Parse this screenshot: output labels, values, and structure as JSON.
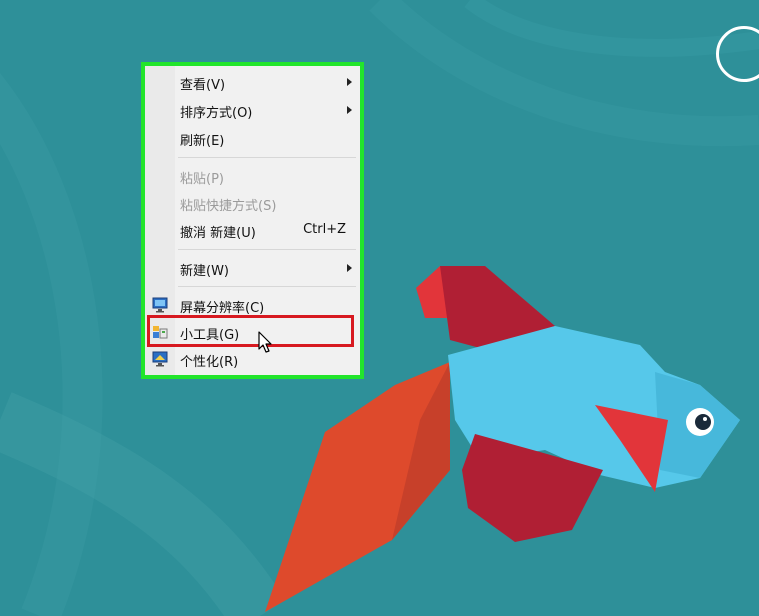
{
  "colors": {
    "desktop_bg": "#2e9099",
    "menu_frame_highlight": "#22e52b",
    "selection_highlight": "#d71920",
    "fish_body": "#56c8ea",
    "fish_red": "#b01f34",
    "fish_red_light": "#e2353a",
    "fish_tail": "#de4a2c"
  },
  "context_menu": {
    "items": [
      {
        "label": "查看(V)",
        "submenu": true
      },
      {
        "label": "排序方式(O)",
        "submenu": true
      },
      {
        "label": "刷新(E)"
      },
      {
        "label": "粘贴(P)",
        "disabled": true
      },
      {
        "label": "粘贴快捷方式(S)",
        "disabled": true
      },
      {
        "label": "撤消 新建(U)",
        "shortcut": "Ctrl+Z"
      },
      {
        "label": "新建(W)",
        "submenu": true
      },
      {
        "label": "屏幕分辨率(C)",
        "icon": "display-icon"
      },
      {
        "label": "小工具(G)",
        "icon": "gadgets-icon"
      },
      {
        "label": "个性化(R)",
        "icon": "personalize-icon"
      }
    ]
  },
  "cursor": {
    "icon": "mouse-pointer-icon"
  },
  "desktop": {
    "top_right_icon": "circle-icon",
    "wallpaper": "betta-fish"
  }
}
